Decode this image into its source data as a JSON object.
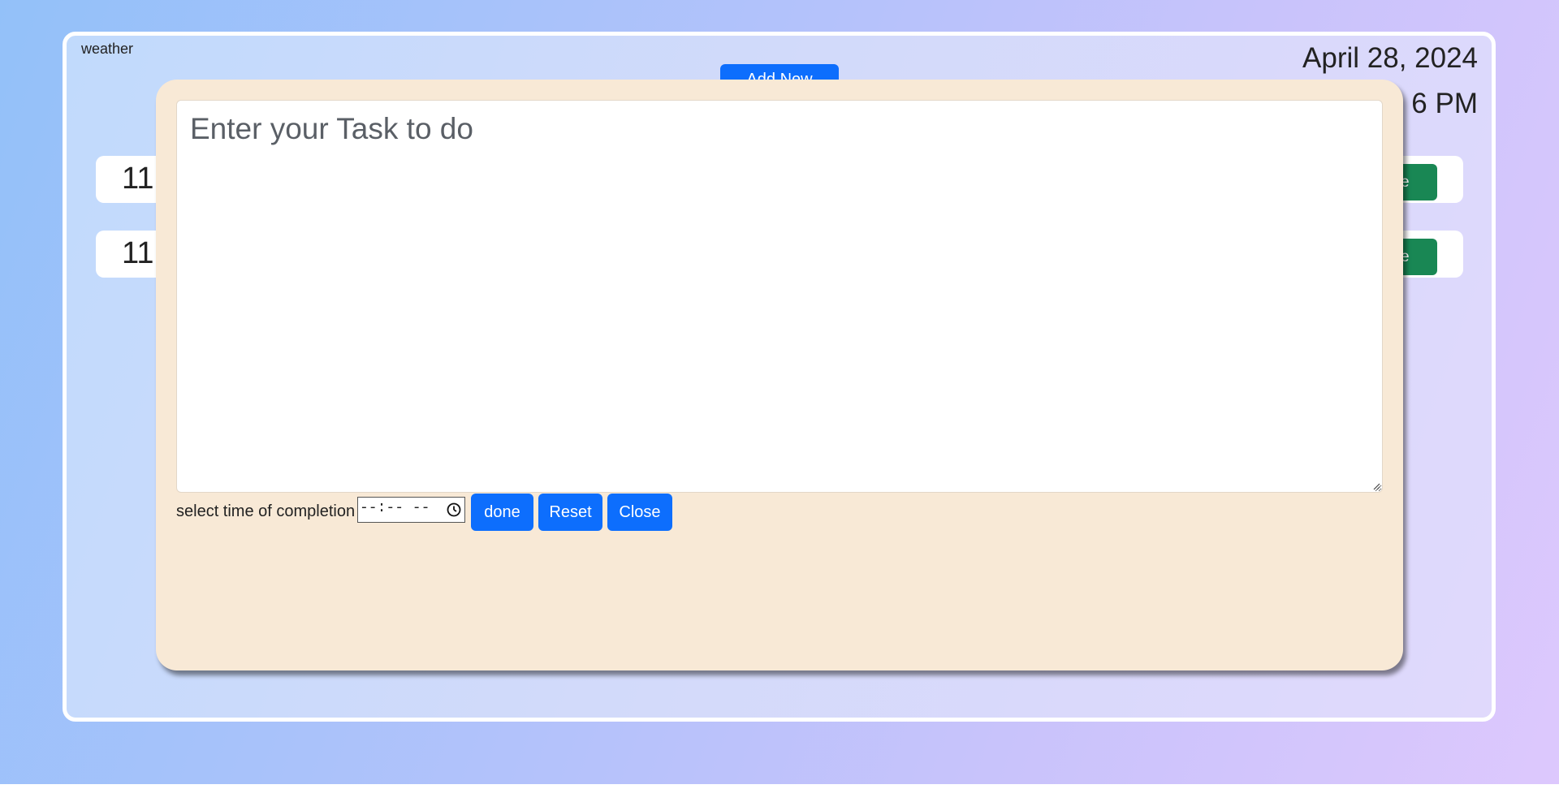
{
  "header": {
    "weather_label": "weather",
    "date": "April 28, 2024",
    "time_partial": "6 PM",
    "add_button_label": "Add New"
  },
  "tasks": [
    {
      "time_partial": "11",
      "done_label": "ne"
    },
    {
      "time_partial": "11",
      "done_label": "ne"
    }
  ],
  "modal": {
    "task_placeholder": "Enter your Task to do",
    "completion_label": "select time of completion",
    "time_value": "--:-- --",
    "done_label": "done",
    "reset_label": "Reset",
    "close_label": "Close"
  },
  "colors": {
    "primary": "#0d6efd",
    "success": "#198754",
    "modal_bg": "#f8e9d6"
  }
}
